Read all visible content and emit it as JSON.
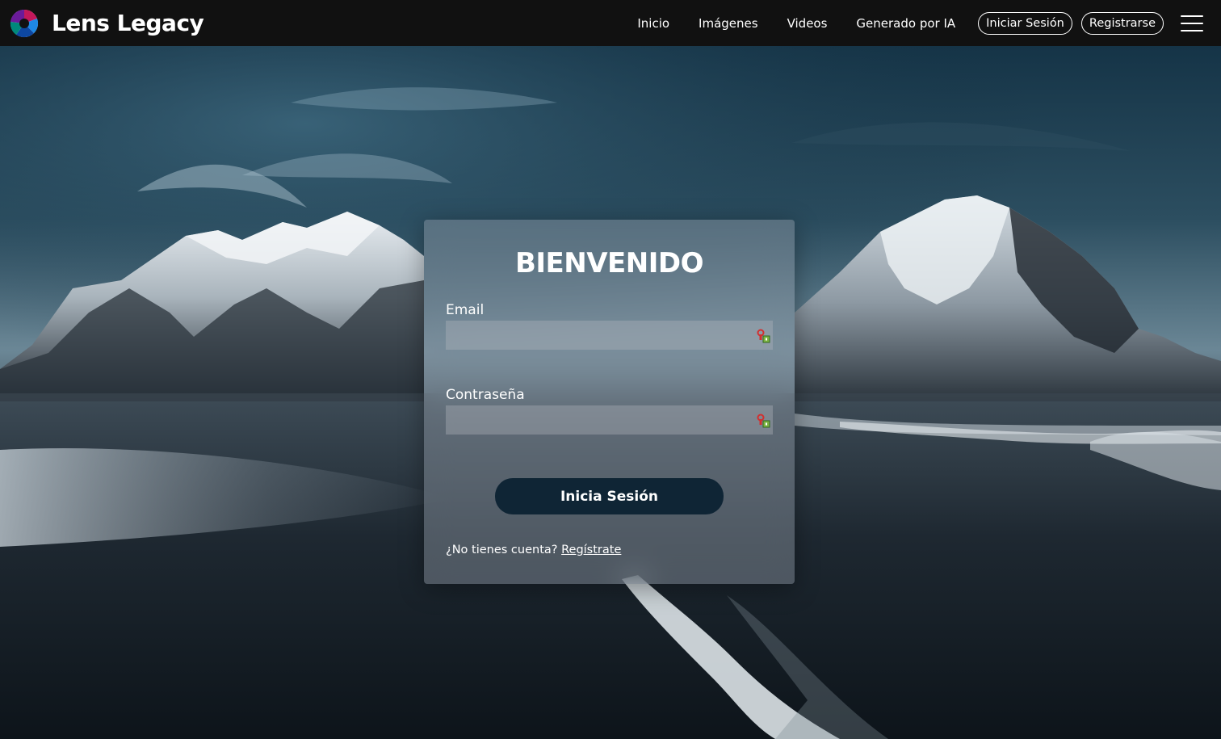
{
  "header": {
    "brand_name": "Lens Legacy",
    "nav": [
      "Inicio",
      "Imágenes",
      "Videos",
      "Generado por IA"
    ],
    "login_button": "Iniciar Sesión",
    "register_button": "Registrarse"
  },
  "login": {
    "title": "BIENVENIDO",
    "email_label": "Email",
    "email_value": "",
    "password_label": "Contraseña",
    "password_value": "",
    "submit_label": "Inicia Sesión",
    "no_account_text": "¿No tienes cuenta?",
    "register_link": "Regístrate"
  },
  "icons": {
    "logo": "camera-aperture-logo",
    "menu": "hamburger-menu-icon",
    "field_autofill": "password-manager-key-icon"
  },
  "colors": {
    "header_bg": "#111111",
    "button_bg": "#0f2535",
    "text": "#ffffff"
  }
}
